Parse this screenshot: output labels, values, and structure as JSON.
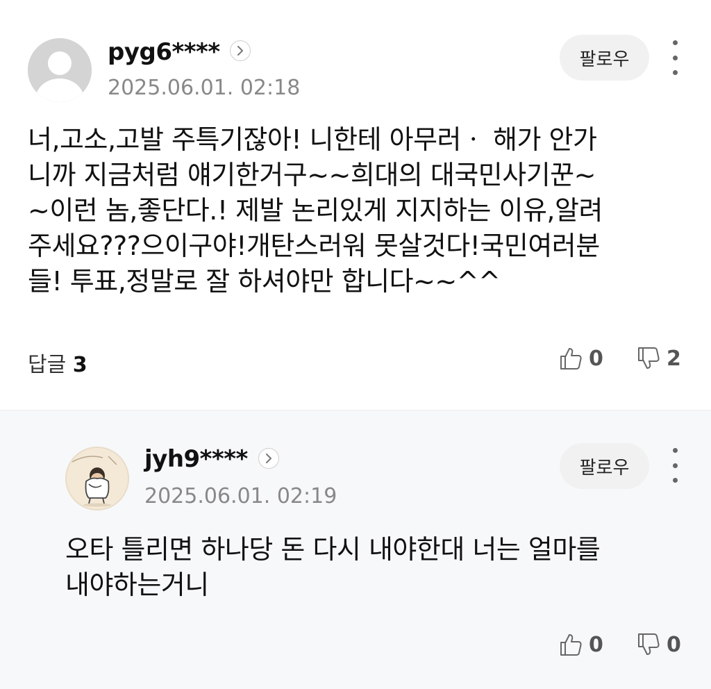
{
  "comments": [
    {
      "username": "pyg6****",
      "timestamp": "2025.06.01. 02:18",
      "follow_label": "팔로우",
      "text_lines": [
        "너,고소,고발 주특기잖아! 니한테 아무러ㆍ 해가 안가",
        "니까 지금처럼 얘기한거구~~희대의 대국민사기꾼~",
        "~이런 놈,좋단다.! 제발 논리있게 지지하는 이유,알려",
        "주세요???으이구야!개탄스러워 못살것다!국민여러분",
        "들! 투표,정말로 잘 하셔야만 합니다~~^^"
      ],
      "reply_label": "답글",
      "reply_count": "3",
      "likes": "0",
      "dislikes": "2",
      "avatar_icon": "default-user-avatar-icon"
    },
    {
      "username": "jyh9****",
      "timestamp": "2025.06.01. 02:19",
      "follow_label": "팔로우",
      "text_lines": [
        "오타 틀리면 하나당 돈 다시 내야한대 너는 얼마를",
        "내야하는거니"
      ],
      "likes": "0",
      "dislikes": "0",
      "avatar_icon": "cartoon-person-avatar-icon"
    }
  ],
  "colors": {
    "reply_background": "#f7f8fa",
    "follow_button": "#f1f1f1",
    "timestamp": "#888888",
    "icon": "#666666"
  }
}
